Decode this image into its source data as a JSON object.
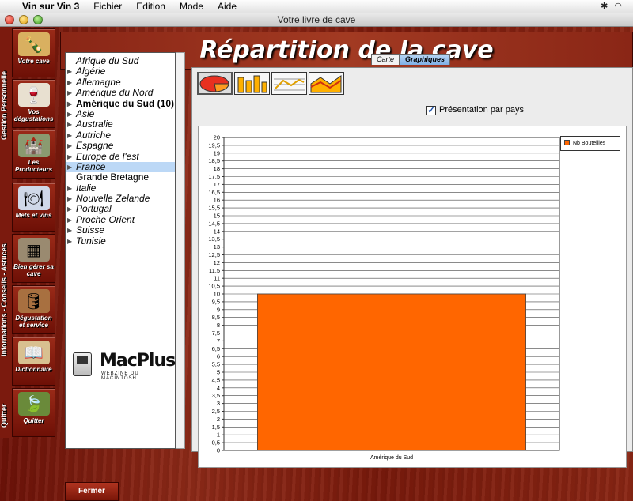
{
  "menubar": {
    "app": "Vin sur Vin 3",
    "items": [
      "Fichier",
      "Edition",
      "Mode",
      "Aide"
    ]
  },
  "window": {
    "title": "Votre livre de cave"
  },
  "header": {
    "title": "Répartition de la cave"
  },
  "sidebar": {
    "groups": [
      "Gestion Personnelle",
      "Informations - Conseils - Astuces",
      "Quitter"
    ],
    "items": [
      {
        "label": "Votre cave",
        "icon": "bottles-icon"
      },
      {
        "label": "Vos dégustations",
        "icon": "wine-glasses-icon"
      },
      {
        "label": "Les Producteurs",
        "icon": "chateau-icon"
      },
      {
        "label": "Mets et vins",
        "icon": "corkscrew-icon"
      },
      {
        "label": "Bien gérer sa cave",
        "icon": "wine-rack-icon"
      },
      {
        "label": "Dégustation et service",
        "icon": "barrel-icon"
      },
      {
        "label": "Dictionnaire",
        "icon": "book-icon"
      },
      {
        "label": "Quitter",
        "icon": "vine-leaf-icon"
      }
    ]
  },
  "countries": [
    {
      "label": "Afrique du Sud",
      "expandable": false,
      "bold": false,
      "selected": false
    },
    {
      "label": "Algérie",
      "expandable": true,
      "bold": false,
      "selected": false
    },
    {
      "label": "Allemagne",
      "expandable": true,
      "bold": false,
      "selected": false
    },
    {
      "label": "Amérique du Nord",
      "expandable": true,
      "bold": false,
      "selected": false
    },
    {
      "label": "Amérique du Sud (10)",
      "expandable": true,
      "bold": true,
      "selected": false
    },
    {
      "label": "Asie",
      "expandable": true,
      "bold": false,
      "selected": false
    },
    {
      "label": "Australie",
      "expandable": true,
      "bold": false,
      "selected": false
    },
    {
      "label": "Autriche",
      "expandable": true,
      "bold": false,
      "selected": false
    },
    {
      "label": "Espagne",
      "expandable": true,
      "bold": false,
      "selected": false
    },
    {
      "label": "Europe de l'est",
      "expandable": true,
      "bold": false,
      "selected": false
    },
    {
      "label": "France",
      "expandable": true,
      "bold": false,
      "selected": true
    },
    {
      "label": "Grande Bretagne",
      "expandable": false,
      "bold": false,
      "selected": false,
      "plain": true
    },
    {
      "label": "Italie",
      "expandable": true,
      "bold": false,
      "selected": false
    },
    {
      "label": "Nouvelle Zelande",
      "expandable": true,
      "bold": false,
      "selected": false
    },
    {
      "label": "Portugal",
      "expandable": true,
      "bold": false,
      "selected": false
    },
    {
      "label": "Proche Orient",
      "expandable": true,
      "bold": false,
      "selected": false
    },
    {
      "label": "Suisse",
      "expandable": true,
      "bold": false,
      "selected": false
    },
    {
      "label": "Tunisie",
      "expandable": true,
      "bold": false,
      "selected": false
    }
  ],
  "logo": {
    "name": "MacPlus",
    "tagline": "WEBZINE DU MACINTOSH"
  },
  "tabs": [
    {
      "label": "Carte",
      "active": false
    },
    {
      "label": "Graphiques",
      "active": true
    }
  ],
  "chart_types": [
    "pie",
    "bar",
    "line",
    "area"
  ],
  "options": {
    "by_country_label": "Présentation par pays",
    "by_country_checked": true
  },
  "colors": {
    "bar": "#ff6600",
    "accent_blue": "#7fb0e6"
  },
  "chart_data": {
    "type": "bar",
    "categories": [
      "Amérique du Sud"
    ],
    "series": [
      {
        "name": "Nb Bouteilles",
        "values": [
          10
        ]
      }
    ],
    "ylim": [
      0,
      20
    ],
    "ytick_step": 0.5,
    "yticks": [
      "0",
      "0,5",
      "1",
      "1,5",
      "2",
      "2,5",
      "3",
      "3,5",
      "4",
      "4,5",
      "5",
      "5,5",
      "6",
      "6,5",
      "7",
      "7,5",
      "8",
      "8,5",
      "9",
      "9,5",
      "10",
      "10,5",
      "11",
      "11,5",
      "12",
      "12,5",
      "13",
      "13,5",
      "14",
      "14,5",
      "15",
      "15,5",
      "16",
      "16,5",
      "17",
      "17,5",
      "18",
      "18,5",
      "19",
      "19,5",
      "20"
    ],
    "grid": true,
    "legend_position": "top-right"
  },
  "footer": {
    "close_label": "Fermer"
  }
}
